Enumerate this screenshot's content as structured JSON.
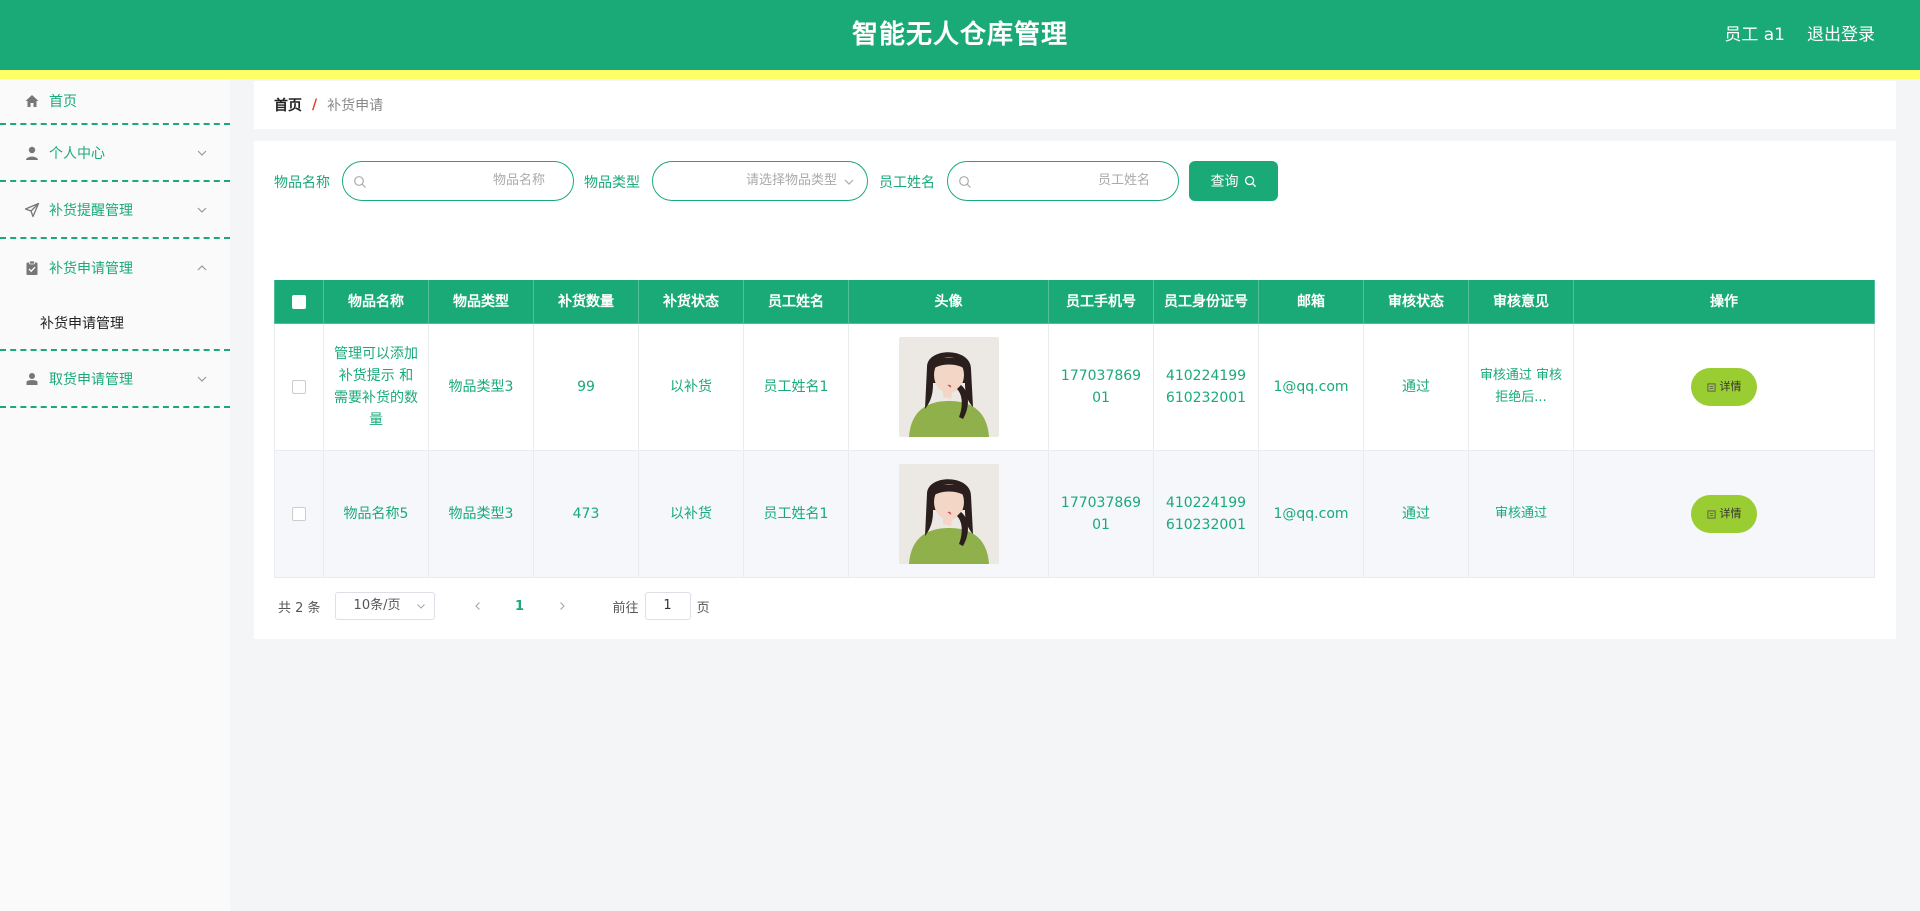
{
  "header": {
    "title": "智能无人仓库管理",
    "user": "员工 a1",
    "logout": "退出登录",
    "color": "#1aaa78",
    "stripe_color": "#ffff66"
  },
  "sidebar": {
    "items": [
      {
        "label": "首页",
        "icon": "home-icon"
      },
      {
        "label": "个人中心",
        "icon": "user-icon"
      },
      {
        "label": "补货提醒管理",
        "icon": "send-icon"
      },
      {
        "label": "补货申请管理",
        "icon": "clipboard-icon"
      },
      {
        "label": "取货申请管理",
        "icon": "user-card-icon"
      }
    ],
    "submenu": {
      "label": "补货申请管理"
    }
  },
  "breadcrumb": {
    "home": "首页",
    "separator": "/",
    "current": "补货申请"
  },
  "search": {
    "item_name_label": "物品名称",
    "item_name_placeholder": "物品名称",
    "item_type_label": "物品类型",
    "item_type_placeholder": "请选择物品类型",
    "employee_name_label": "员工姓名",
    "employee_name_placeholder": "员工姓名",
    "query_button": "查询"
  },
  "table": {
    "columns": [
      "物品名称",
      "物品类型",
      "补货数量",
      "补货状态",
      "员工姓名",
      "头像",
      "员工手机号",
      "员工身份证号",
      "邮箱",
      "审核状态",
      "审核意见",
      "操作"
    ],
    "rows": [
      {
        "item_name": "管理可以添加补货提示 和需要补货的数量",
        "item_type": "物品类型3",
        "quantity": "99",
        "status": "以补货",
        "employee": "员工姓名1",
        "phone": "17703786901",
        "id_number": "410224199610232001",
        "email": "1@qq.com",
        "review_status": "通过",
        "review_opinion": "审核通过 审核拒绝后...",
        "action": "详情"
      },
      {
        "item_name": "物品名称5",
        "item_type": "物品类型3",
        "quantity": "473",
        "status": "以补货",
        "employee": "员工姓名1",
        "phone": "17703786901",
        "id_number": "410224199610232001",
        "email": "1@qq.com",
        "review_status": "通过",
        "review_opinion": "审核通过",
        "action": "详情"
      }
    ]
  },
  "pagination": {
    "total": "共 2 条",
    "page_size": "10条/页",
    "current_page": "1",
    "goto_label": "前往",
    "goto_value": "1",
    "page_suffix": "页"
  }
}
